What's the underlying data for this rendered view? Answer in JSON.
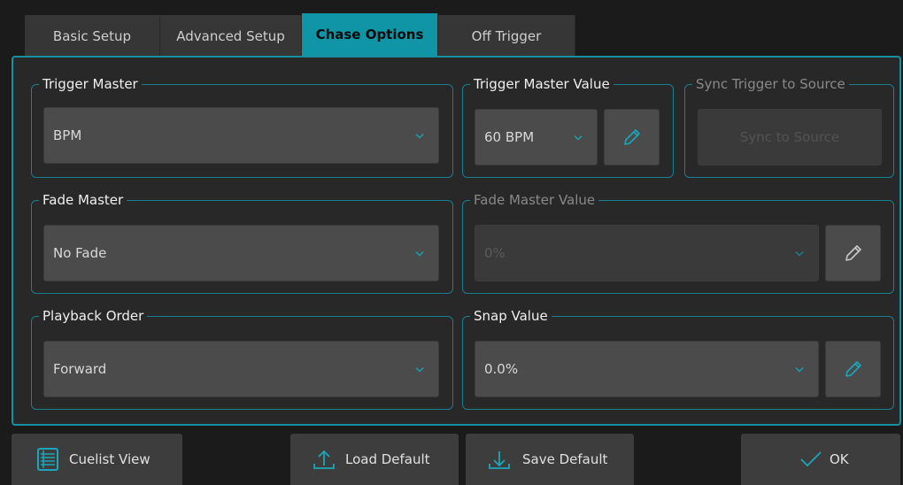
{
  "tabs": [
    "Basic Setup",
    "Advanced Setup",
    "Chase Options",
    "Off Trigger"
  ],
  "active_tab": "Chase Options",
  "trigger_master": {
    "label": "Trigger Master",
    "value": "BPM"
  },
  "trigger_master_value": {
    "label": "Trigger Master Value",
    "value": "60 BPM"
  },
  "sync_trigger": {
    "label": "Sync Trigger to Source",
    "button": "Sync to Source"
  },
  "fade_master": {
    "label": "Fade Master",
    "value": "No Fade"
  },
  "fade_master_value": {
    "label": "Fade Master Value",
    "value": "0%"
  },
  "playback_order": {
    "label": "Playback Order",
    "value": "Forward"
  },
  "snap_value": {
    "label": "Snap Value",
    "value": "0.0%"
  },
  "footer": {
    "cuelist_view": "Cuelist View",
    "load_default": "Load Default",
    "save_default": "Save Default",
    "ok": "OK"
  },
  "colors": {
    "accent": "#0f95a6",
    "background": "#1b1b1b",
    "panel": "#282828",
    "control": "#4b4b4b"
  }
}
